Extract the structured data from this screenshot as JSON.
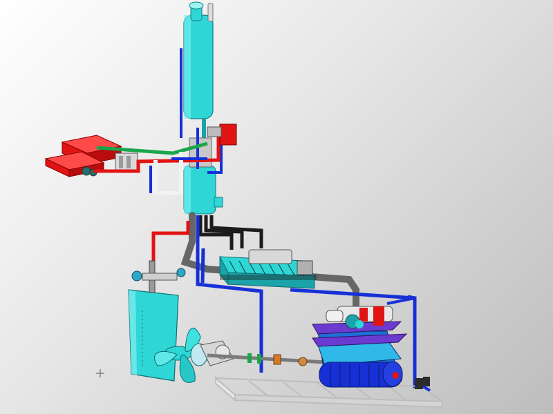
{
  "canvas": {
    "background_colors": [
      "#ffffff",
      "#e8e8e8",
      "#bdbdbd"
    ]
  },
  "colors": {
    "cyan": "#2fd6d6",
    "cyan_dark": "#1aa3a8",
    "red": "#e11414",
    "blue": "#1730d6",
    "green": "#1aa64a",
    "grey_pipe": "#666666",
    "purple": "#6b3ad0",
    "white_pipe": "#f2f2f2",
    "frame": "#e6e6e6"
  },
  "icons": {
    "cursor": "crosshair-cursor-icon"
  }
}
